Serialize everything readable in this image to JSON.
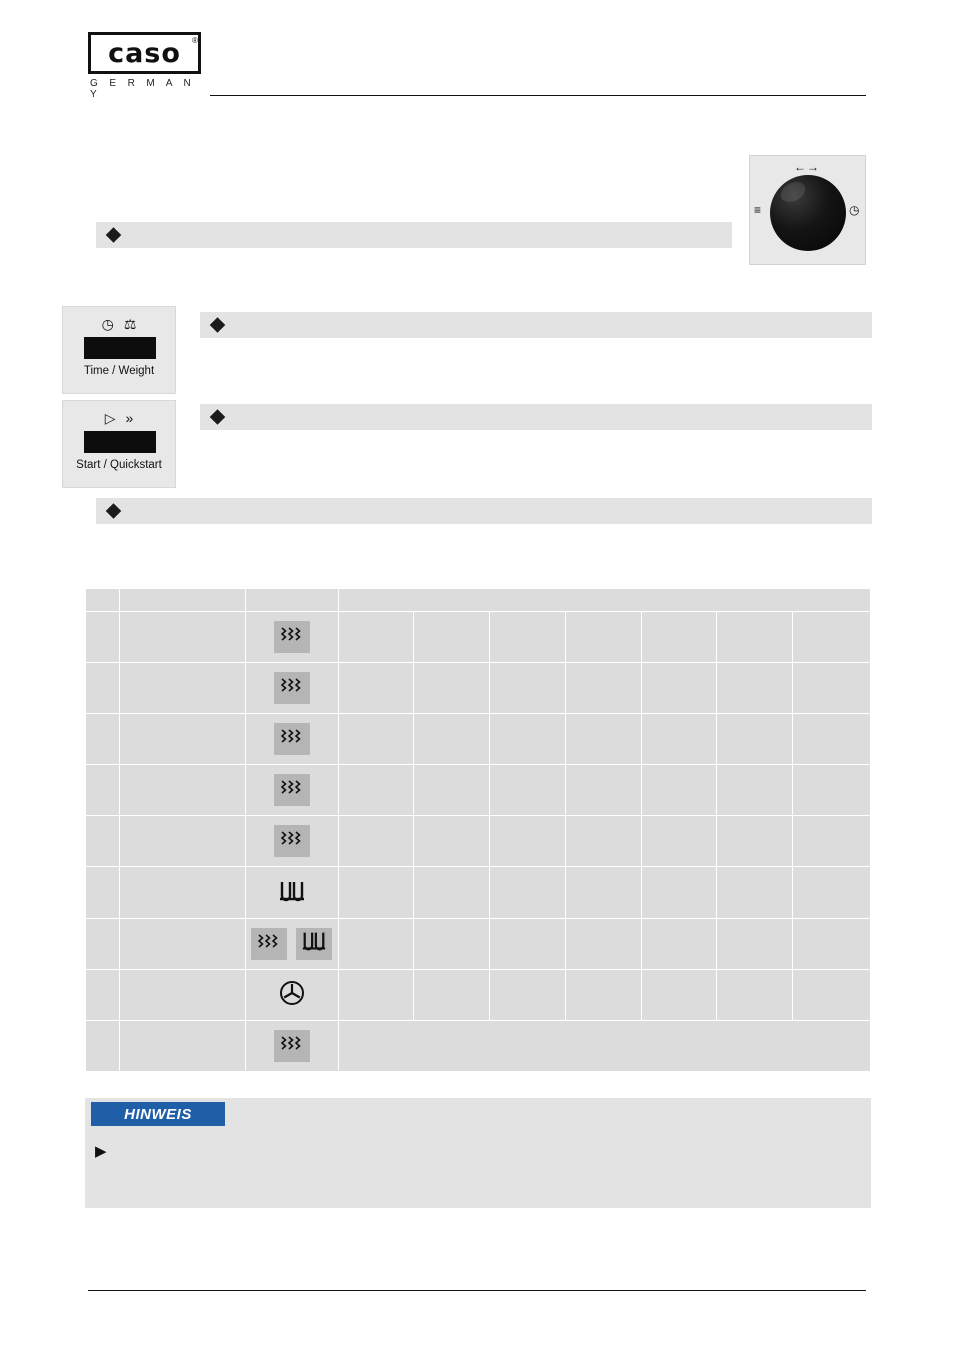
{
  "header": {
    "logo_word": "caso",
    "logo_reg": "®",
    "logo_sub": "G E R M A N Y"
  },
  "dial": {
    "panel_name": "rotary-knob-panel",
    "marks": {
      "top": "←→",
      "left": "≡",
      "right": "◷"
    }
  },
  "keys": [
    {
      "icons": [
        "◷",
        "⚖"
      ],
      "caption": "Time / Weight"
    },
    {
      "icons": [
        "▷",
        "»"
      ],
      "caption": "Start / Quickstart"
    }
  ],
  "notes": [
    {
      "text": ""
    },
    {
      "text": ""
    },
    {
      "text": ""
    },
    {
      "text": ""
    }
  ],
  "table": {
    "header": [
      "",
      "",
      "",
      "",
      "",
      "",
      "",
      "",
      "",
      ""
    ],
    "rows": [
      {
        "no": "",
        "name": "",
        "icons": [
          "wave"
        ],
        "cells": [
          "",
          "",
          "",
          "",
          "",
          "",
          ""
        ]
      },
      {
        "no": "",
        "name": "",
        "icons": [
          "wave"
        ],
        "cells": [
          "",
          "",
          "",
          "",
          "",
          "",
          ""
        ]
      },
      {
        "no": "",
        "name": "",
        "icons": [
          "wave"
        ],
        "cells": [
          "",
          "",
          "",
          "",
          "",
          "",
          ""
        ]
      },
      {
        "no": "",
        "name": "",
        "icons": [
          "wave"
        ],
        "cells": [
          "",
          "",
          "",
          "",
          "",
          "",
          ""
        ]
      },
      {
        "no": "",
        "name": "",
        "icons": [
          "wave"
        ],
        "cells": [
          "",
          "",
          "",
          "",
          "",
          "",
          ""
        ]
      },
      {
        "no": "",
        "name": "",
        "icons": [
          "grill"
        ],
        "cells": [
          "",
          "",
          "",
          "",
          "",
          "",
          ""
        ]
      },
      {
        "no": "",
        "name": "",
        "icons": [
          "wave",
          "grill"
        ],
        "cells": [
          "",
          "",
          "",
          "",
          "",
          "",
          ""
        ]
      },
      {
        "no": "",
        "name": "",
        "icons": [
          "defrost"
        ],
        "cells": [
          "",
          "",
          "",
          "",
          "",
          "",
          ""
        ]
      },
      {
        "no": "",
        "name": "",
        "icons": [
          "wave"
        ],
        "cells": [
          ""
        ]
      }
    ]
  },
  "hinweis": {
    "title": "HINWEIS",
    "arrow": "▶",
    "text": ""
  },
  "footer": {
    "text": ""
  },
  "colors": {
    "note_bg": "#e3e3e3",
    "table_cell": "#dcdcdc",
    "badge": "#b5b5b5",
    "hinweis_blue": "#1f5fa8",
    "ink": "#111111"
  }
}
